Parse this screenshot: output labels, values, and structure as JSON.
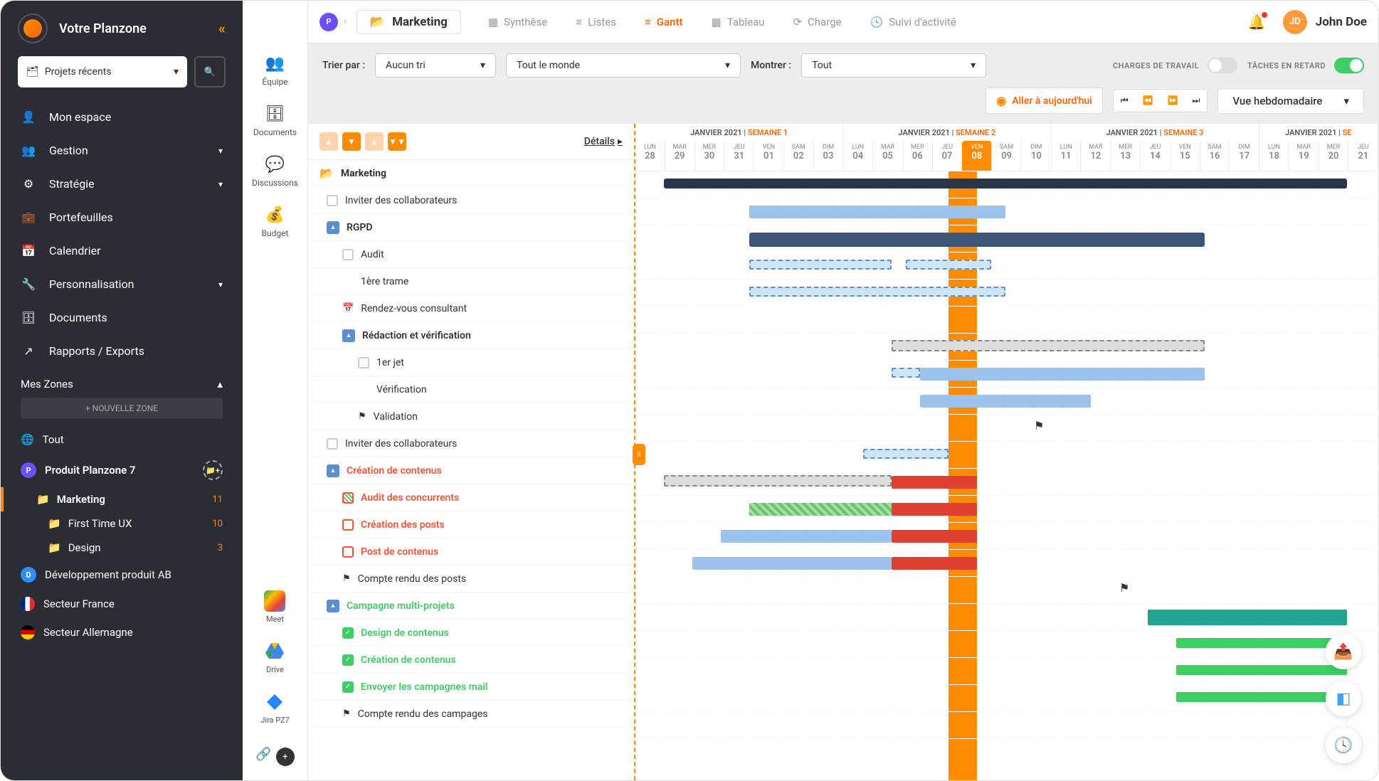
{
  "app": {
    "title": "Votre Planzone"
  },
  "sidebar": {
    "recents_label": "Projets récents",
    "nav": [
      {
        "label": "Mon espace",
        "icon": "👤"
      },
      {
        "label": "Gestion",
        "icon": "👥",
        "chev": true
      },
      {
        "label": "Stratégie",
        "icon": "⚙",
        "chev": true
      },
      {
        "label": "Portefeuilles",
        "icon": "💼"
      },
      {
        "label": "Calendrier",
        "icon": "📅"
      },
      {
        "label": "Personnalisation",
        "icon": "🔧",
        "chev": true
      },
      {
        "label": "Documents",
        "icon": "🗄"
      },
      {
        "label": "Rapports / Exports",
        "icon": "↗"
      }
    ],
    "zones_title": "Mes Zones",
    "new_zone": "+ NOUVELLE ZONE",
    "zones": {
      "all": "Tout",
      "p1": "Produit Planzone 7",
      "marketing": "Marketing",
      "marketing_count": "11",
      "ux": "First Time UX",
      "ux_count": "10",
      "design": "Design",
      "design_count": "3",
      "dev": "Développement produit AB",
      "fr": "Secteur France",
      "de": "Secteur Allemagne"
    }
  },
  "mini": {
    "items": [
      {
        "label": "Équipe",
        "icon": "👥"
      },
      {
        "label": "Documents",
        "icon": "🗄"
      },
      {
        "label": "Discussions",
        "icon": "💬"
      },
      {
        "label": "Budget",
        "icon": "💰"
      }
    ],
    "apps": [
      {
        "label": "Meet"
      },
      {
        "label": "Drive"
      },
      {
        "label": "Jira PZ7"
      }
    ]
  },
  "topbar": {
    "project": "Marketing",
    "tabs": [
      {
        "label": "Synthèse"
      },
      {
        "label": "Listes"
      },
      {
        "label": "Gantt",
        "active": true
      },
      {
        "label": "Tableau"
      },
      {
        "label": "Charge"
      },
      {
        "label": "Suivi d'activité"
      }
    ],
    "user": {
      "initials": "JD",
      "name": "John Doe"
    }
  },
  "filter": {
    "sort_label": "Trier par :",
    "sort_value": "Aucun tri",
    "scope_value": "Tout le monde",
    "show_label": "Montrer :",
    "show_value": "Tout",
    "charges_label": "CHARGES DE TRAVAIL",
    "late_label": "TÂCHES EN RETARD"
  },
  "nav": {
    "today": "Aller à aujourd'hui",
    "view": "Vue hebdomadaire"
  },
  "gantt": {
    "details": "Détails",
    "weeks": [
      {
        "month": "JANVIER 2021",
        "label": "SEMAINE 1"
      },
      {
        "month": "JANVIER 2021",
        "label": "SEMAINE 2"
      },
      {
        "month": "JANVIER 2021",
        "label": "SEMAINE 3"
      },
      {
        "month": "JANVIER 2021",
        "label": "SE"
      }
    ],
    "days": [
      {
        "d": "LUN",
        "n": "28"
      },
      {
        "d": "MAR",
        "n": "29"
      },
      {
        "d": "MER",
        "n": "30"
      },
      {
        "d": "JEU",
        "n": "31"
      },
      {
        "d": "VEN",
        "n": "01"
      },
      {
        "d": "SAM",
        "n": "02"
      },
      {
        "d": "DIM",
        "n": "03"
      },
      {
        "d": "LUN",
        "n": "04"
      },
      {
        "d": "MAR",
        "n": "05"
      },
      {
        "d": "MER",
        "n": "06"
      },
      {
        "d": "JEU",
        "n": "07"
      },
      {
        "d": "VEN",
        "n": "08",
        "today": true
      },
      {
        "d": "SAM",
        "n": "09"
      },
      {
        "d": "DIM",
        "n": "10"
      },
      {
        "d": "LUN",
        "n": "11"
      },
      {
        "d": "MAR",
        "n": "12"
      },
      {
        "d": "MER",
        "n": "13"
      },
      {
        "d": "JEU",
        "n": "14"
      },
      {
        "d": "VEN",
        "n": "15"
      },
      {
        "d": "SAM",
        "n": "16"
      },
      {
        "d": "DIM",
        "n": "17"
      },
      {
        "d": "LUN",
        "n": "18"
      },
      {
        "d": "MAR",
        "n": "19"
      },
      {
        "d": "MER",
        "n": "20"
      },
      {
        "d": "JEU",
        "n": "21"
      }
    ],
    "rows": [
      {
        "type": "section",
        "label": "Marketing"
      },
      {
        "type": "task",
        "indent": 1,
        "check": "empty",
        "label": "Inviter des collaborateurs"
      },
      {
        "type": "group",
        "indent": 1,
        "label": "RGPD"
      },
      {
        "type": "task",
        "indent": 2,
        "check": "empty",
        "label": "Audit"
      },
      {
        "type": "task",
        "indent": 2,
        "check": "none",
        "label": "1ère trame"
      },
      {
        "type": "event",
        "indent": 2,
        "label": "Rendez-vous consultant"
      },
      {
        "type": "group",
        "indent": 2,
        "label": "Rédaction et vérification"
      },
      {
        "type": "task",
        "indent": 3,
        "check": "empty",
        "label": "1er jet"
      },
      {
        "type": "task",
        "indent": 3,
        "check": "none",
        "label": "Vérification"
      },
      {
        "type": "milestone",
        "indent": 3,
        "label": "Validation"
      },
      {
        "type": "task",
        "indent": 1,
        "check": "empty",
        "label": "Inviter des collaborateurs"
      },
      {
        "type": "group",
        "indent": 1,
        "label": "Création de contenus",
        "cls": "red"
      },
      {
        "type": "task",
        "indent": 2,
        "check": "partial",
        "label": "Audit des concurrents",
        "cls": "red"
      },
      {
        "type": "task",
        "indent": 2,
        "check": "red",
        "label": "Création des posts",
        "cls": "red"
      },
      {
        "type": "task",
        "indent": 2,
        "check": "red",
        "label": "Post de contenus",
        "cls": "red"
      },
      {
        "type": "milestone",
        "indent": 2,
        "label": "Compte rendu des posts"
      },
      {
        "type": "group",
        "indent": 1,
        "label": "Campagne multi-projets",
        "cls": "green"
      },
      {
        "type": "task",
        "indent": 2,
        "check": "checked",
        "label": "Design de contenus",
        "cls": "green"
      },
      {
        "type": "task",
        "indent": 2,
        "check": "checked",
        "label": "Création de contenus",
        "cls": "green"
      },
      {
        "type": "task",
        "indent": 2,
        "check": "checked",
        "label": "Envoyer les campagnes mail",
        "cls": "green"
      },
      {
        "type": "milestone",
        "indent": 2,
        "label": "Compte rendu des campages"
      }
    ]
  }
}
